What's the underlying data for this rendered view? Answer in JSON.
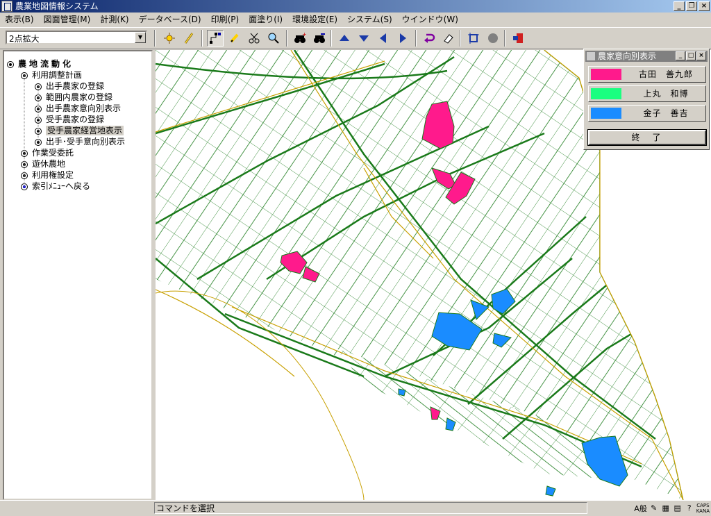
{
  "window": {
    "title": "農業地図情報システム"
  },
  "menu": [
    "表示(B)",
    "図面管理(M)",
    "計測(K)",
    "データベース(D)",
    "印刷(P)",
    "面塗り(I)",
    "環境設定(E)",
    "システム(S)",
    "ウインドウ(W)"
  ],
  "toolbar": {
    "zoom_mode": "2点拡大"
  },
  "tree": {
    "root": "農地流動化",
    "group": "利用調整計画",
    "items": [
      "出手農家の登録",
      "範囲内農家の登録",
      "出手農家意向別表示",
      "受手農家の登録",
      "受手農家経営地表示",
      "出手･受手意向別表示"
    ],
    "others": [
      "作業受委託",
      "遊休農地",
      "利用権設定"
    ],
    "back": "索引ﾒﾆｭｰへ戻る"
  },
  "dialog": {
    "title": "農家意向別表示",
    "farmers": [
      {
        "name": "古田　善九郎",
        "color": "#ff1a8c"
      },
      {
        "name": "上丸　和博",
        "color": "#1aff80"
      },
      {
        "name": "金子　善吉",
        "color": "#1a8cff"
      }
    ],
    "end_label": "終　了"
  },
  "status": {
    "message": "コマンドを選択"
  },
  "tray": {
    "ime": "A般",
    "caps": "CAPS",
    "kana": "KANA"
  },
  "colors": {
    "parcel_line": "#1a7a1a",
    "road_line": "#c8a000",
    "map_bg": "#ffffff"
  }
}
